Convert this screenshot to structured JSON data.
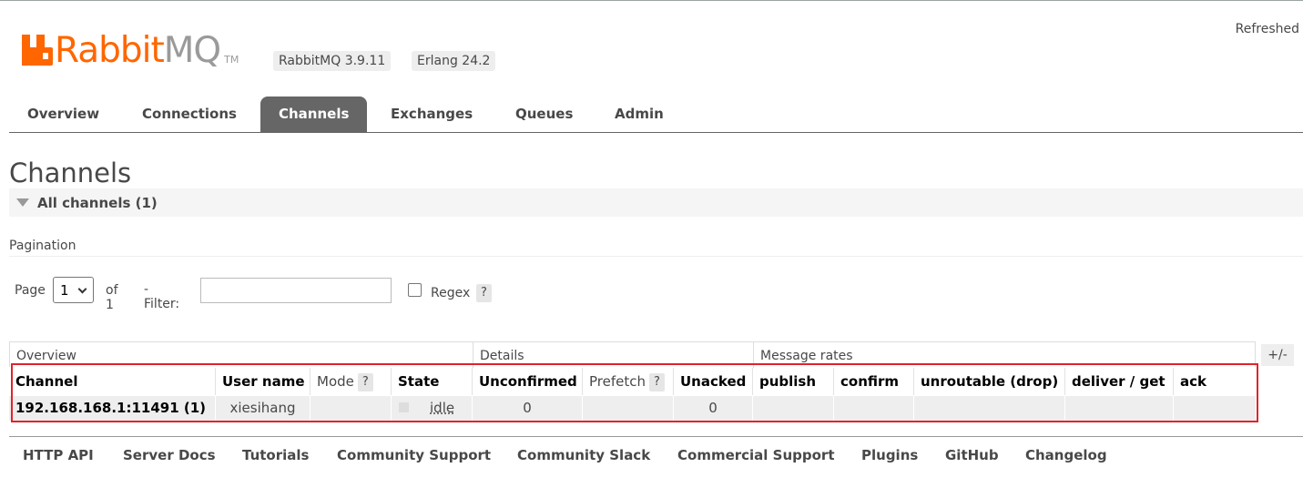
{
  "header": {
    "logo_brand": "Rabbit",
    "logo_mq": "MQ",
    "logo_tm": "TM",
    "version_badge": "RabbitMQ 3.9.11",
    "erlang_badge": "Erlang 24.2",
    "refreshed": "Refreshed"
  },
  "tabs": [
    {
      "label": "Overview",
      "active": false
    },
    {
      "label": "Connections",
      "active": false
    },
    {
      "label": "Channels",
      "active": true
    },
    {
      "label": "Exchanges",
      "active": false
    },
    {
      "label": "Queues",
      "active": false
    },
    {
      "label": "Admin",
      "active": false
    }
  ],
  "page_title": "Channels",
  "section": {
    "label": "All channels (1)"
  },
  "pagination": {
    "title": "Pagination",
    "page_label": "Page",
    "page_value": "1",
    "of_label": "of 1",
    "filter_label": "- Filter:",
    "filter_value": "",
    "regex_label": "Regex",
    "regex_checked": false,
    "help": "?"
  },
  "table": {
    "groups": [
      "Overview",
      "Details",
      "Message rates"
    ],
    "toggle": "+/-",
    "columns": [
      "Channel",
      "User name",
      "Mode",
      "State",
      "Unconfirmed",
      "Prefetch",
      "Unacked",
      "publish",
      "confirm",
      "unroutable (drop)",
      "deliver / get",
      "ack"
    ],
    "help": "?",
    "rows": [
      {
        "channel": "192.168.168.1:11491 (1)",
        "user": "xiesihang",
        "mode": "",
        "state": "idle",
        "unconfirmed": "0",
        "prefetch": "",
        "unacked": "0",
        "publish": "",
        "confirm": "",
        "unroutable": "",
        "deliver_get": "",
        "ack": ""
      }
    ]
  },
  "footer": [
    "HTTP API",
    "Server Docs",
    "Tutorials",
    "Community Support",
    "Community Slack",
    "Commercial Support",
    "Plugins",
    "GitHub",
    "Changelog"
  ],
  "colors": {
    "brand": "#ff6600",
    "highlight": "#e0232b",
    "active_tab": "#666666"
  }
}
